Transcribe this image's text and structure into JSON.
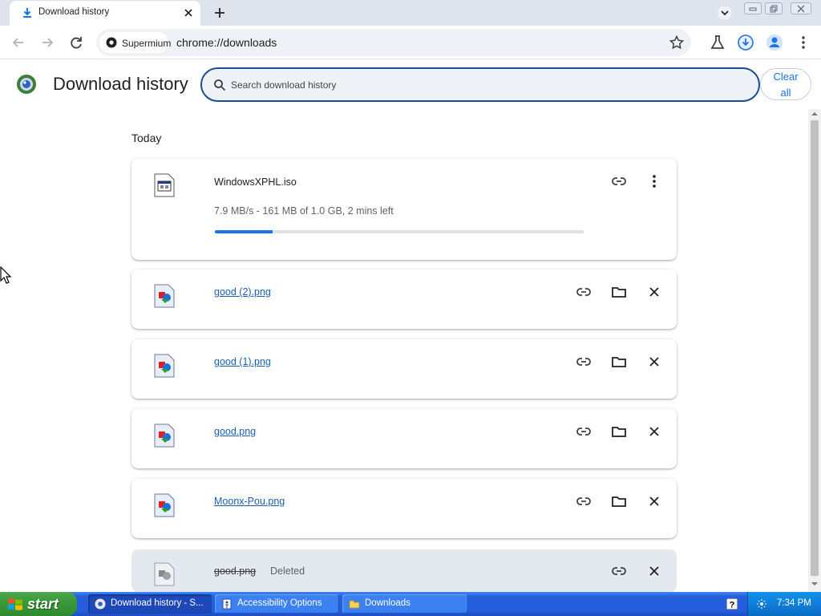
{
  "browser": {
    "tab_title": "Download history",
    "url": "chrome://downloads",
    "site_chip": "Supermium",
    "icons": {
      "tab": "download-icon",
      "close": "close-icon",
      "new_tab": "plus-icon",
      "tab_search": "chevron-down-icon",
      "back": "arrow-left-icon",
      "forward": "arrow-right-icon",
      "reload": "reload-icon",
      "bookmark": "star-icon",
      "labs": "flask-icon",
      "downloads": "download-circle-icon",
      "profile": "person-icon",
      "menu": "kebab-menu-icon"
    }
  },
  "page": {
    "title": "Download history",
    "search_placeholder": "Search download history",
    "clear_all_label": "Clear all",
    "section_label": "Today"
  },
  "downloads": [
    {
      "filename": "WindowsXPHL.iso",
      "status": "7.9 MB/s - 161 MB of 1.0 GB, 2 mins left",
      "progress_percent": 15.7,
      "state": "in-progress",
      "icon": "iso-file-icon",
      "actions": [
        "copy-link-icon",
        "more-vert-icon"
      ]
    },
    {
      "filename": "good (2).png",
      "state": "complete",
      "icon": "png-file-icon",
      "actions": [
        "copy-link-icon",
        "folder-icon",
        "close-icon"
      ]
    },
    {
      "filename": "good (1).png",
      "state": "complete",
      "icon": "png-file-icon",
      "actions": [
        "copy-link-icon",
        "folder-icon",
        "close-icon"
      ]
    },
    {
      "filename": "good.png",
      "state": "complete",
      "icon": "png-file-icon",
      "actions": [
        "copy-link-icon",
        "folder-icon",
        "close-icon"
      ]
    },
    {
      "filename": "Moonx-Pou.png",
      "state": "complete",
      "icon": "png-file-icon",
      "actions": [
        "copy-link-icon",
        "folder-icon",
        "close-icon"
      ]
    },
    {
      "filename": "good.png",
      "status": "Deleted",
      "state": "deleted",
      "icon": "png-file-icon",
      "actions": [
        "copy-link-icon",
        "close-icon"
      ]
    }
  ],
  "taskbar": {
    "start_label": "start",
    "tasks": [
      {
        "label": "Download history - S...",
        "active": true,
        "icon": "browser-icon"
      },
      {
        "label": "Accessibility Options",
        "active": false,
        "icon": "accessibility-icon"
      },
      {
        "label": "Downloads",
        "active": false,
        "icon": "folder-icon"
      }
    ],
    "clock": "7:34 PM"
  },
  "colors": {
    "accent": "#1a73e8",
    "link": "#1a5fb4",
    "search_border": "#1a4f8f",
    "taskbar_blue": "#245edb",
    "start_green": "#3a9a3a"
  }
}
